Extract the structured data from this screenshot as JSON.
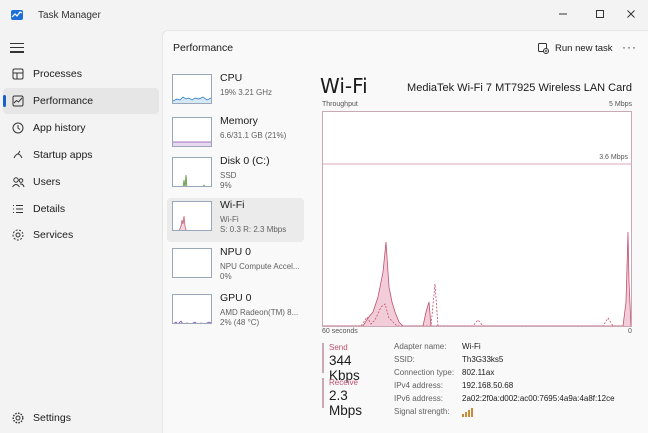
{
  "window": {
    "title": "Task Manager"
  },
  "sidebar": {
    "items": [
      {
        "label": "Processes",
        "icon": "processes-icon"
      },
      {
        "label": "Performance",
        "icon": "performance-icon",
        "active": true
      },
      {
        "label": "App history",
        "icon": "app-history-icon"
      },
      {
        "label": "Startup apps",
        "icon": "startup-apps-icon"
      },
      {
        "label": "Users",
        "icon": "users-icon"
      },
      {
        "label": "Details",
        "icon": "details-icon"
      },
      {
        "label": "Services",
        "icon": "services-icon"
      }
    ],
    "settings_label": "Settings"
  },
  "header": {
    "page_title": "Performance",
    "run_new_task": "Run new task",
    "more": "···"
  },
  "resources": [
    {
      "name": "CPU",
      "line1": "19%  3.21 GHz",
      "line2": "",
      "thumb_color": "#1a73c7"
    },
    {
      "name": "Memory",
      "line1": "6.6/31.1 GB (21%)",
      "line2": "",
      "thumb_color": "#8a46b0"
    },
    {
      "name": "Disk 0 (C:)",
      "line1": "SSD",
      "line2": "9%",
      "thumb_color": "#4d8a2e"
    },
    {
      "name": "Wi-Fi",
      "line1": "Wi-Fi",
      "line2": "S: 0.3  R: 2.3 Mbps",
      "thumb_color": "#c0506e",
      "active": true
    },
    {
      "name": "NPU 0",
      "line1": "NPU Compute Accel...",
      "line2": "0%",
      "thumb_color": "#1a73c7"
    },
    {
      "name": "GPU 0",
      "line1": "AMD Radeon(TM) 8...",
      "line2": "2%  (48 °C)",
      "thumb_color": "#7a3fb5"
    }
  ],
  "detail": {
    "title": "Wi-Fi",
    "device": "MediaTek Wi-Fi 7 MT7925 Wireless LAN Card",
    "throughput_label": "Throughput",
    "max_label": "5 Mbps",
    "ref_label": "3.6 Mbps",
    "time_left": "60 seconds",
    "time_right": "0",
    "accent": "#c0506e"
  },
  "stats": {
    "send_label": "Send",
    "send_value": "344 Kbps",
    "receive_label": "Receive",
    "receive_value": "2.3 Mbps"
  },
  "properties": [
    {
      "key": "Adapter name:",
      "value": "Wi-Fi"
    },
    {
      "key": "SSID:",
      "value": "Th3G33ks5"
    },
    {
      "key": "Connection type:",
      "value": "802.11ax"
    },
    {
      "key": "IPv4 address:",
      "value": "192.168.50.68"
    },
    {
      "key": "IPv6 address:",
      "value": "2a02:2f0a:d002:ac00:7695:4a9a:4a8f:12ce"
    },
    {
      "key": "Signal strength:",
      "value": ""
    }
  ]
}
